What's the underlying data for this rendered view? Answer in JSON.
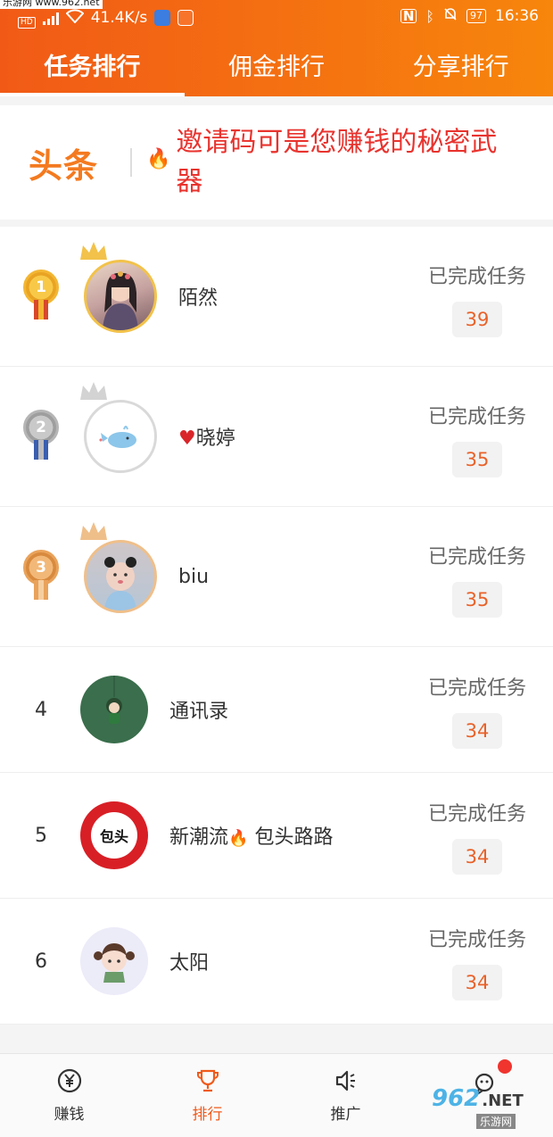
{
  "status_bar": {
    "site_tag": "乐游网 www.962.net",
    "hd": "HD",
    "speed": "41.4K/s",
    "battery": "97",
    "time": "16:36"
  },
  "tabs": [
    {
      "label": "任务排行",
      "active": true
    },
    {
      "label": "佣金排行",
      "active": false
    },
    {
      "label": "分享排行",
      "active": false
    }
  ],
  "banner": {
    "brand": "头条",
    "text": "邀请码可是您赚钱的秘密武器"
  },
  "ranking": [
    {
      "rank": "1",
      "name": "陌然",
      "stat_label": "已完成任务",
      "count": "39"
    },
    {
      "rank": "2",
      "name": "晓婷",
      "stat_label": "已完成任务",
      "count": "35"
    },
    {
      "rank": "3",
      "name": "biu",
      "stat_label": "已完成任务",
      "count": "35"
    },
    {
      "rank": "4",
      "name": "通讯录",
      "stat_label": "已完成任务",
      "count": "34"
    },
    {
      "rank": "5",
      "name": "新潮流",
      "name_suffix": "包头路路",
      "stat_label": "已完成任务",
      "count": "34"
    },
    {
      "rank": "6",
      "name": "太阳",
      "stat_label": "已完成任务",
      "count": "34"
    }
  ],
  "avatar_text": {
    "baotou": "包头"
  },
  "bottom_nav": [
    {
      "label": "赚钱",
      "icon": "yen-coin-icon"
    },
    {
      "label": "排行",
      "icon": "trophy-icon"
    },
    {
      "label": "推广",
      "icon": "speaker-icon"
    },
    {
      "label": "",
      "icon": "chat-bot-icon"
    }
  ],
  "watermark": {
    "logo": "962",
    "suffix": ".NET",
    "sub": "乐游网"
  },
  "colors": {
    "accent": "#f15a16",
    "count": "#e8622a",
    "banner_text": "#e8332e",
    "gold": "#f2b02c",
    "silver": "#b8b8b8",
    "bronze": "#e9a25a"
  }
}
